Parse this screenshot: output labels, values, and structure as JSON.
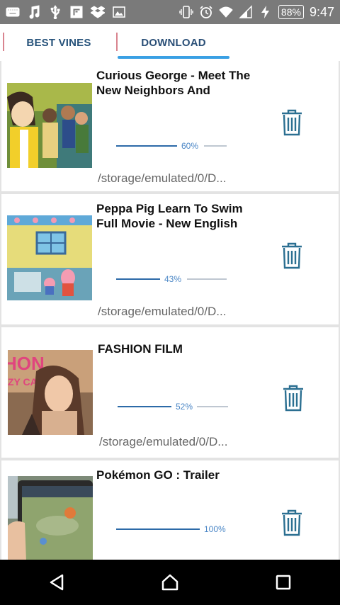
{
  "status_bar": {
    "left_icons": [
      "keyboard-icon",
      "music-icon",
      "usb-icon",
      "flipboard-icon",
      "dropbox-icon",
      "image-icon"
    ],
    "right_icons": [
      "vibrate-icon",
      "alarm-icon",
      "wifi-icon",
      "signal-icon",
      "charging-icon"
    ],
    "battery": "88%",
    "time": "9:47"
  },
  "tabs": [
    {
      "label": "BEST VINES",
      "selected": false
    },
    {
      "label": "DOWNLOAD",
      "selected": true
    }
  ],
  "colors": {
    "accent": "#3aa0e4",
    "tab_text": "#26527a",
    "tab_separator": "#d9848f",
    "progress_done": "#2c6aa8",
    "progress_rest": "#bfc7d1",
    "trash": "#2b6f91",
    "status_bar": "#7a7a7a",
    "nav_bar": "#000000"
  },
  "downloads": [
    {
      "title": "Curious George - Meet The New Neighbors And",
      "progress_label": "60%",
      "progress": 60,
      "path": "/storage/emulated/0/D...",
      "thumbnail": "curious-george-thumbnail"
    },
    {
      "title": "Peppa Pig Learn To Swim Full Movie - New English",
      "progress_label": "43%",
      "progress": 43,
      "path": "/storage/emulated/0/D...",
      "thumbnail": "peppa-pig-thumbnail"
    },
    {
      "title": "FASHION FILM",
      "progress_label": "52%",
      "progress": 52,
      "path": "/storage/emulated/0/D...",
      "thumbnail": "fashion-film-thumbnail"
    },
    {
      "title": "Pokémon GO : Trailer",
      "progress_label": "100%",
      "progress": 100,
      "path": "",
      "thumbnail": "pokemon-go-thumbnail"
    }
  ],
  "nav": [
    "back-icon",
    "home-icon",
    "recents-icon"
  ]
}
